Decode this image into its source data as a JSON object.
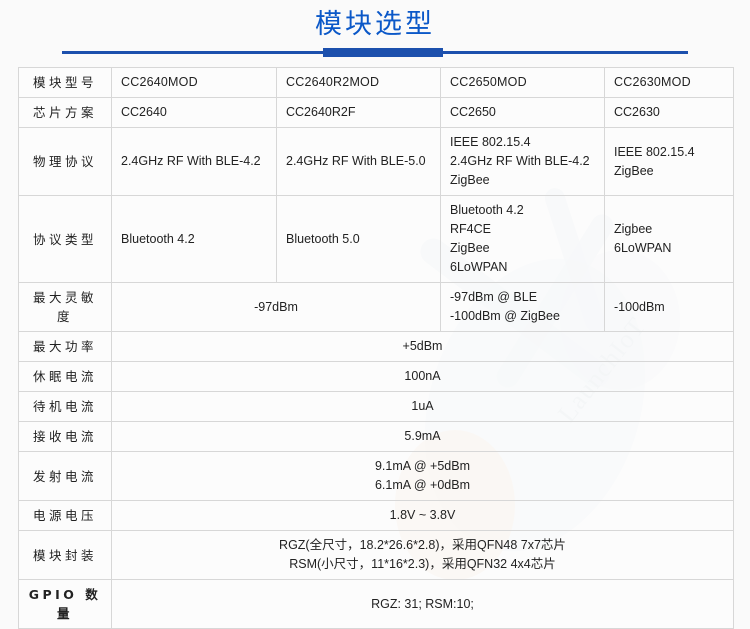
{
  "header": {
    "title": "模块选型",
    "rule": "title-rule"
  },
  "watermark": {
    "brand": "LaunchIoT"
  },
  "table": {
    "row_labels": [
      "模块型号",
      "芯片方案",
      "物理协议",
      "协议类型",
      "最大灵敏度",
      "最大功率",
      "休眠电流",
      "待机电流",
      "接收电流",
      "发射电流",
      "电源电压",
      "模块封装",
      "GPIO 数量"
    ],
    "models": [
      "CC2640MOD",
      "CC2640R2MOD",
      "CC2650MOD",
      "CC2630MOD"
    ],
    "chip": [
      "CC2640",
      "CC2640R2F",
      "CC2650",
      "CC2630"
    ],
    "phy": [
      [
        "2.4GHz RF With BLE-4.2"
      ],
      [
        "2.4GHz RF With BLE-5.0"
      ],
      [
        "IEEE 802.15.4",
        "2.4GHz RF With BLE-4.2",
        "ZigBee"
      ],
      [
        "IEEE 802.15.4",
        "ZigBee"
      ]
    ],
    "protocol": [
      [
        "Bluetooth 4.2"
      ],
      [
        "Bluetooth 5.0"
      ],
      [
        "Bluetooth 4.2",
        "RF4CE",
        "ZigBee",
        "6LoWPAN"
      ],
      [
        "Zigbee",
        "6LoWPAN"
      ]
    ],
    "sensitivity": {
      "merged_12": "-97dBm",
      "col3": [
        "-97dBm @ BLE",
        "-100dBm @ ZigBee"
      ],
      "col4": [
        "-100dBm"
      ]
    },
    "max_power": "+5dBm",
    "sleep_current": "100nA",
    "standby_current": "1uA",
    "rx_current": "5.9mA",
    "tx_current": [
      "9.1mA @ +5dBm",
      "6.1mA @ +0dBm"
    ],
    "supply_voltage": "1.8V ~ 3.8V",
    "package": [
      "RGZ(全尺寸，18.2*26.6*2.8)，采用QFN48 7x7芯片",
      "RSM(小尺寸，11*16*2.3)，采用QFN32 4x4芯片"
    ],
    "gpio_count": "RGZ: 31;  RSM:10;"
  },
  "colors": {
    "title_blue": "#0b58c8",
    "rule_blue": "#1c50ad",
    "label_blue": "#1455c8",
    "model_magenta": "#e6007e",
    "border_gray": "#d7d7d7",
    "page_bg": "#fafafa"
  }
}
